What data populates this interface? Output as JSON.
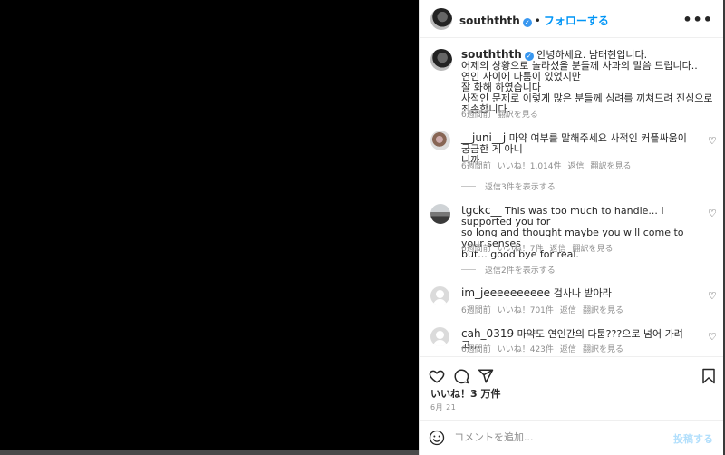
{
  "header": {
    "username": "souththth",
    "verified_badge": "✓",
    "follow_separator": "•",
    "follow_label": "フォローする",
    "more_label": "•••"
  },
  "caption": {
    "username": "souththth",
    "lines": [
      "안녕하세요. 남태현입니다.",
      "어제의 상황으로 놀라셨을 분들께 사과의 말씀 드립니다..",
      "연인 사이에 다툼이 있었지만",
      "잘 화해 하였습니다",
      "사적인 문제로 이렇게 많은 분들께 심려를 끼쳐드려 진심으로 죄송합니다."
    ],
    "time": "6週間前",
    "translate": "翻訳を見る"
  },
  "comments": [
    {
      "username": "__juni__j",
      "text_line1": "마약 여부를 말해주세요 사적인 커플싸움이 궁금한 게 아니",
      "text_line2": "니까",
      "time": "6週間前",
      "likes": "いいね！1,014件",
      "reply": "返信",
      "translate": "翻訳を見る",
      "view_replies": "返信3件を表示する"
    },
    {
      "username": "tgckc__",
      "text_line1": "This was too much to handle... I supported you for",
      "text_line2": "so long and thought maybe you will come to your senses",
      "text_line3": "but... good bye for real.",
      "time": "6週間前",
      "likes": "いいね！7件",
      "reply": "返信",
      "translate": "翻訳を見る",
      "view_replies": "返信2件を表示する"
    },
    {
      "username": "im_jeeeeeeeeee",
      "text_line1": "검사나 받아라",
      "time": "6週間前",
      "likes": "いいね！701件",
      "reply": "返信",
      "translate": "翻訳を見る"
    },
    {
      "username": "cah_0319",
      "text_line1": "마약도 연인간의 다툼???으로 넘어 가려고,,,",
      "time": "6週間前",
      "likes": "いいね！423件",
      "reply": "返信",
      "translate": "翻訳を見る"
    }
  ],
  "footer": {
    "likes_count": "いいね！3 万件",
    "date": "6月 21",
    "comment_placeholder": "コメントを追加...",
    "post_label": "投稿する"
  },
  "icons": {
    "heart": "heart-icon",
    "comment": "comment-icon",
    "share": "share-icon",
    "bookmark": "bookmark-icon",
    "emoji": "emoji-icon"
  },
  "colors": {
    "accent": "#0095f6",
    "text": "#262626",
    "muted": "#8e8e8e",
    "verified": "#3897f0"
  }
}
